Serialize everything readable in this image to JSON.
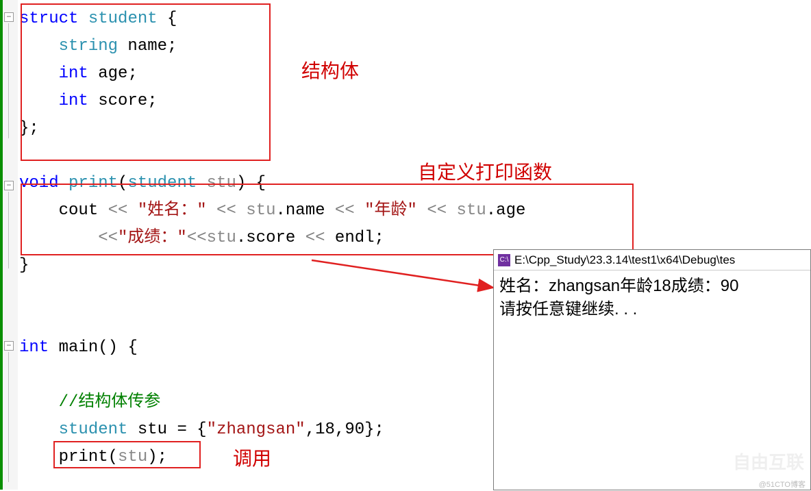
{
  "annotations": {
    "struct": "结构体",
    "print_fn": "自定义打印函数",
    "call": "调用"
  },
  "code": {
    "l1_struct": "struct",
    "l1_student": "student",
    "l1_brace": " {",
    "l2_type": "string",
    "l2_name": " name",
    "l2_semi": ";",
    "l3_type": "int",
    "l3_name": " age",
    "l3_semi": ";",
    "l4_type": "int",
    "l4_name": " score",
    "l4_semi": ";",
    "l5": "};",
    "l7_void": "void",
    "l7_print": " print",
    "l7_par_open": "(",
    "l7_stu_t": "student",
    "l7_stu_n": " stu",
    "l7_par_close": ")",
    "l7_brace": " {",
    "l8_cout": "    cout ",
    "l8_op1": "<< ",
    "l8_str1": "\"姓名：\"",
    "l8_op2": " << ",
    "l8_stu1": "stu",
    "l8_name": ".name ",
    "l8_op3": "<< ",
    "l8_str2": "\"年龄\"",
    "l8_op4": " << ",
    "l8_stu2": "stu",
    "l8_age": ".age",
    "l9_op1": "        <<",
    "l9_str": "\"成绩：\"",
    "l9_op2": "<<",
    "l9_stu": "stu",
    "l9_score": ".score ",
    "l9_op3": "<< ",
    "l9_endl": "endl",
    "l9_semi": ";",
    "l10": "}",
    "l13_int": "int",
    "l13_main": " main() {",
    "l15_com": "//结构体传参",
    "l16_stu_t": "student",
    "l16_var": " stu ",
    "l16_eq": "= {",
    "l16_str": "\"zhangsan\"",
    "l16_nums": ",18,90}",
    "l16_semi": ";",
    "l17_print": "print",
    "l17_par_open": "(",
    "l17_stu": "stu",
    "l17_par_close": ")",
    "l17_semi": ";"
  },
  "console": {
    "title": "E:\\Cpp_Study\\23.3.14\\test1\\x64\\Debug\\tes",
    "icon": "C:\\",
    "line1": "姓名：zhangsan年龄18成绩：90",
    "line2": "请按任意键继续. . ."
  },
  "watermark_text": "@51CTO博客",
  "logo_text": "自由互联"
}
